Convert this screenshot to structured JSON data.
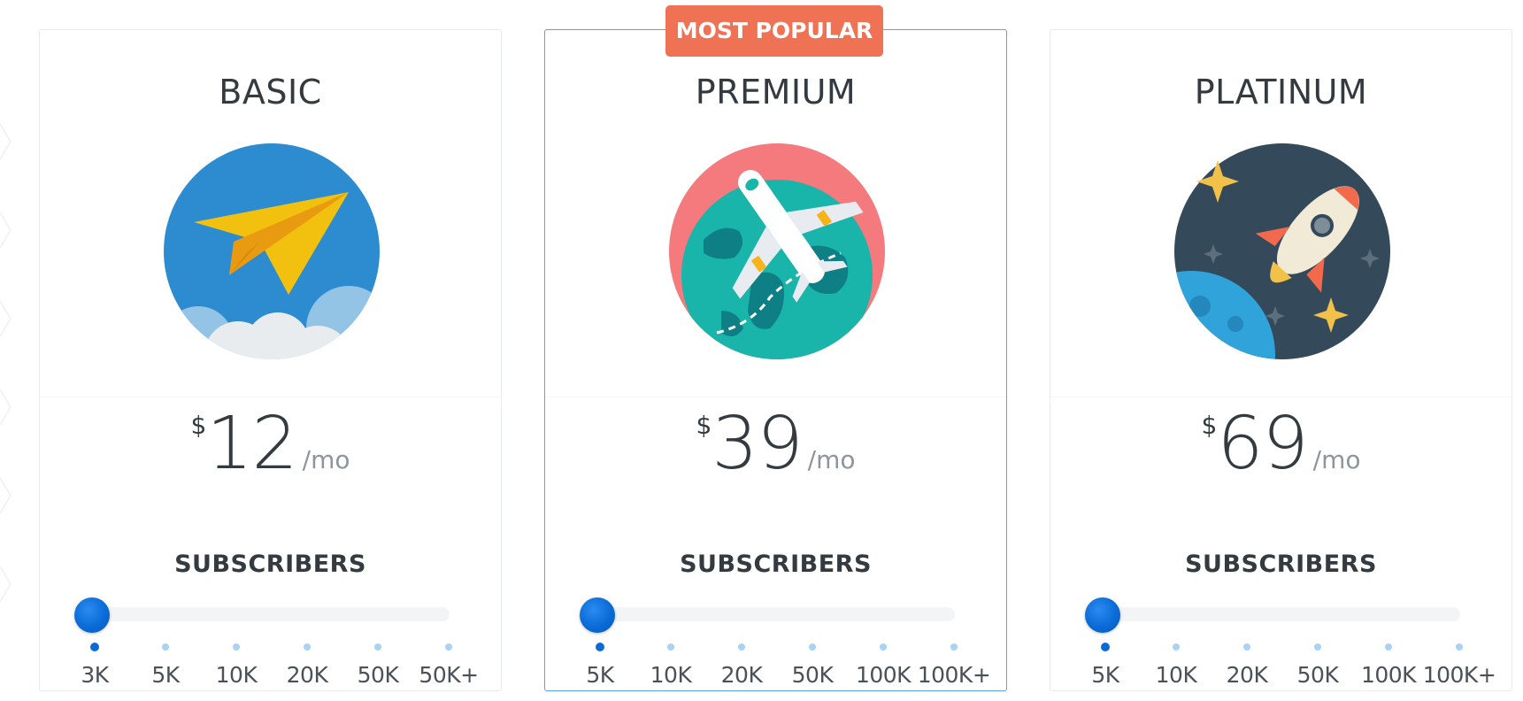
{
  "badge": "MOST POPULAR",
  "plans": [
    {
      "name": "BASIC",
      "currency": "$",
      "price": "12",
      "period": "/mo",
      "subscribers_label": "SUBSCRIBERS",
      "illustration": "paper-plane-icon",
      "slider_value_index": 0,
      "ticks": [
        "3K",
        "5K",
        "10K",
        "20K",
        "50K",
        "50K+"
      ]
    },
    {
      "name": "PREMIUM",
      "currency": "$",
      "price": "39",
      "period": "/mo",
      "subscribers_label": "SUBSCRIBERS",
      "illustration": "airplane-globe-icon",
      "slider_value_index": 0,
      "ticks": [
        "5K",
        "10K",
        "20K",
        "50K",
        "100K",
        "100K+"
      ]
    },
    {
      "name": "PLATINUM",
      "currency": "$",
      "price": "69",
      "period": "/mo",
      "subscribers_label": "SUBSCRIBERS",
      "illustration": "rocket-icon",
      "slider_value_index": 0,
      "ticks": [
        "5K",
        "10K",
        "20K",
        "50K",
        "100K",
        "100K+"
      ]
    }
  ],
  "colors": {
    "accent": "#0a6bd8",
    "badge": "#f07255",
    "featured_border": "#57a4e6"
  }
}
